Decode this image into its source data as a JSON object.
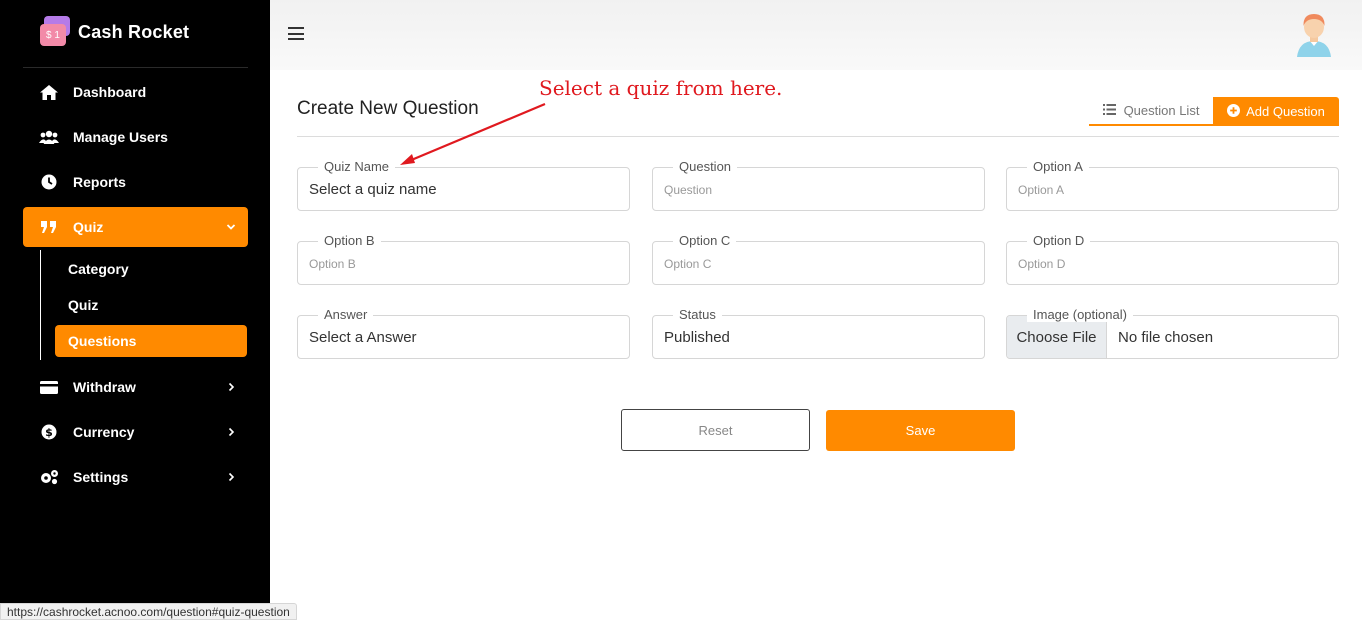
{
  "brand": {
    "name": "Cash Rocket",
    "logo_glyph": "$ 1"
  },
  "nav": {
    "dashboard": "Dashboard",
    "manage_users": "Manage Users",
    "reports": "Reports",
    "quiz": "Quiz",
    "withdraw": "Withdraw",
    "currency": "Currency",
    "settings": "Settings"
  },
  "quiz_submenu": {
    "category": "Category",
    "quiz": "Quiz",
    "questions": "Questions"
  },
  "page": {
    "title": "Create New Question",
    "tab_list": "Question List",
    "tab_add": "Add Question"
  },
  "form": {
    "quiz_name": {
      "label": "Quiz Name",
      "value": "Select a quiz name"
    },
    "question": {
      "label": "Question",
      "placeholder": "Question"
    },
    "option_a": {
      "label": "Option A",
      "placeholder": "Option A"
    },
    "option_b": {
      "label": "Option B",
      "placeholder": "Option B"
    },
    "option_c": {
      "label": "Option C",
      "placeholder": "Option C"
    },
    "option_d": {
      "label": "Option D",
      "placeholder": "Option D"
    },
    "answer": {
      "label": "Answer",
      "value": "Select a Answer"
    },
    "status": {
      "label": "Status",
      "value": "Published"
    },
    "image": {
      "label": "Image (optional)",
      "choose_label": "Choose File",
      "file_status": "No file chosen"
    }
  },
  "buttons": {
    "reset": "Reset",
    "save": "Save"
  },
  "annotation": "Select a quiz from here.",
  "status_bar": {
    "url": "https://cashrocket.acnoo.com/question#quiz-question"
  },
  "colors": {
    "accent": "#ff8a00",
    "sidebar_bg": "#000000",
    "annotation": "#e0191f"
  }
}
